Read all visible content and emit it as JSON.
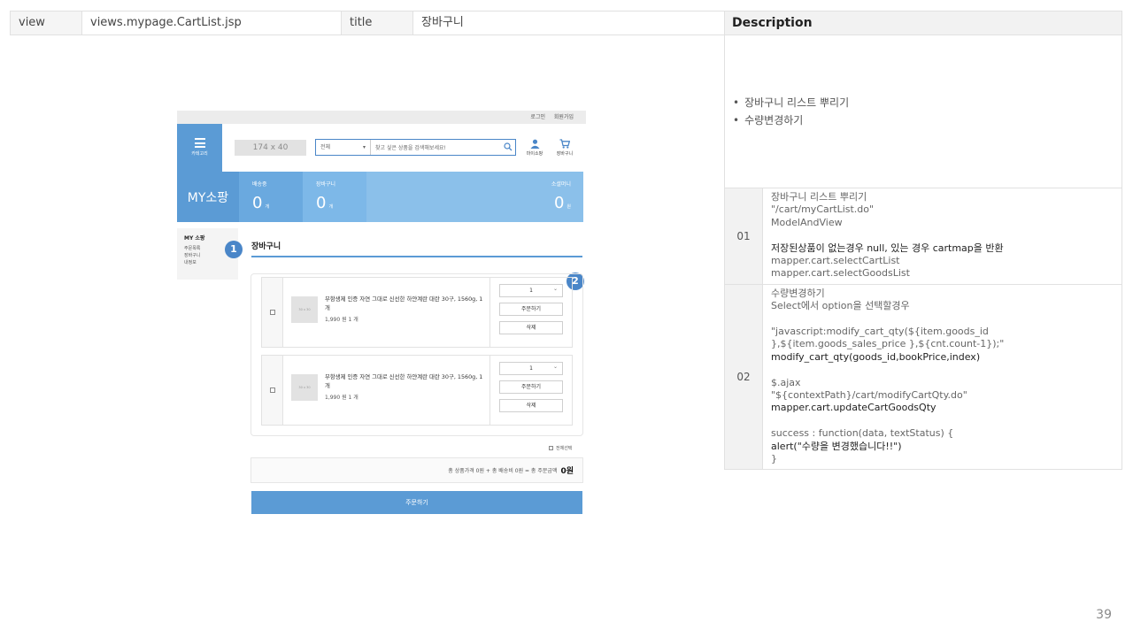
{
  "header_row": {
    "view_label": "view",
    "view_value": "views.mypage.CartList.jsp",
    "title_label": "title",
    "title_value": "장바구니"
  },
  "description": {
    "heading": "Description",
    "summary": [
      "장바구니 리스트 뿌리기",
      "수량변경하기"
    ],
    "rows": [
      {
        "num": "01",
        "lines": [
          "장바구니 리스트 뿌리기",
          "\"/cart/myCartList.do\"",
          "ModelAndView",
          "",
          "저장된상품이 없는경우 null, 있는 경우 cartmap을 반환",
          "mapper.cart.selectCartList",
          "mapper.cart.selectGoodsList"
        ]
      },
      {
        "num": "02",
        "lines": [
          "수량변경하기",
          "Select에서 option을 선택할경우",
          "",
          "\"javascript:modify_cart_qty(${item.goods_id },${item.goods_sales_price },${cnt.count-1});\"",
          "modify_cart_qty(goods_id,bookPrice,index)",
          "",
          "$.ajax",
          "\"${contextPath}/cart/modifyCartQty.do\"",
          "mapper.cart.updateCartGoodsQty",
          "",
          "success : function(data, textStatus) {",
          "alert(\"수량을 변경했습니다!!\")",
          "}"
        ]
      }
    ]
  },
  "mockup": {
    "top_links": [
      "로그인",
      "회원가입"
    ],
    "category_label": "카테고리",
    "logo_placeholder": "174 x 40",
    "search": {
      "select_value": "전체",
      "placeholder": "찾고 싶은 상품을 검색해보세요!"
    },
    "mypage_label": "마이소팡",
    "cart_label": "장바구니",
    "my_title": "MY소팡",
    "stats": [
      {
        "label": "배송중",
        "value": "0",
        "unit": "개"
      },
      {
        "label": "장바구니",
        "value": "0",
        "unit": "개"
      },
      {
        "label": "소셜머니",
        "value": "0",
        "unit": "원"
      }
    ],
    "side": {
      "title": "MY 소팡",
      "items": [
        "주문목록",
        "장바구니",
        "내정보"
      ]
    },
    "badges": [
      "1",
      "2"
    ],
    "cart_title": "장바구니",
    "items": [
      {
        "thumb": "30 x 30",
        "name": "무항생제 인증 자연 그대로 신선한 하얀계란 대란 30구, 1560g, 1개",
        "price": "1,990 원  1 개",
        "qty": "1",
        "order_btn": "주문하기",
        "delete_btn": "삭제"
      },
      {
        "thumb": "30 x 30",
        "name": "무항생제 인증 자연 그대로 신선한 하얀계란 대란 30구, 1560g, 1개",
        "price": "1,990 원  1 개",
        "qty": "1",
        "order_btn": "주문하기",
        "delete_btn": "삭제"
      }
    ],
    "select_all": "전체선택",
    "total_text": "총 상품가격 0원 + 총 배송비 0원 = 총 주문금액",
    "total_amount": "0원",
    "order_button": "주문하기"
  },
  "page_number": "39",
  "colors": {
    "primary_blue": "#5b9bd5",
    "badge_blue": "#4a86c8"
  }
}
